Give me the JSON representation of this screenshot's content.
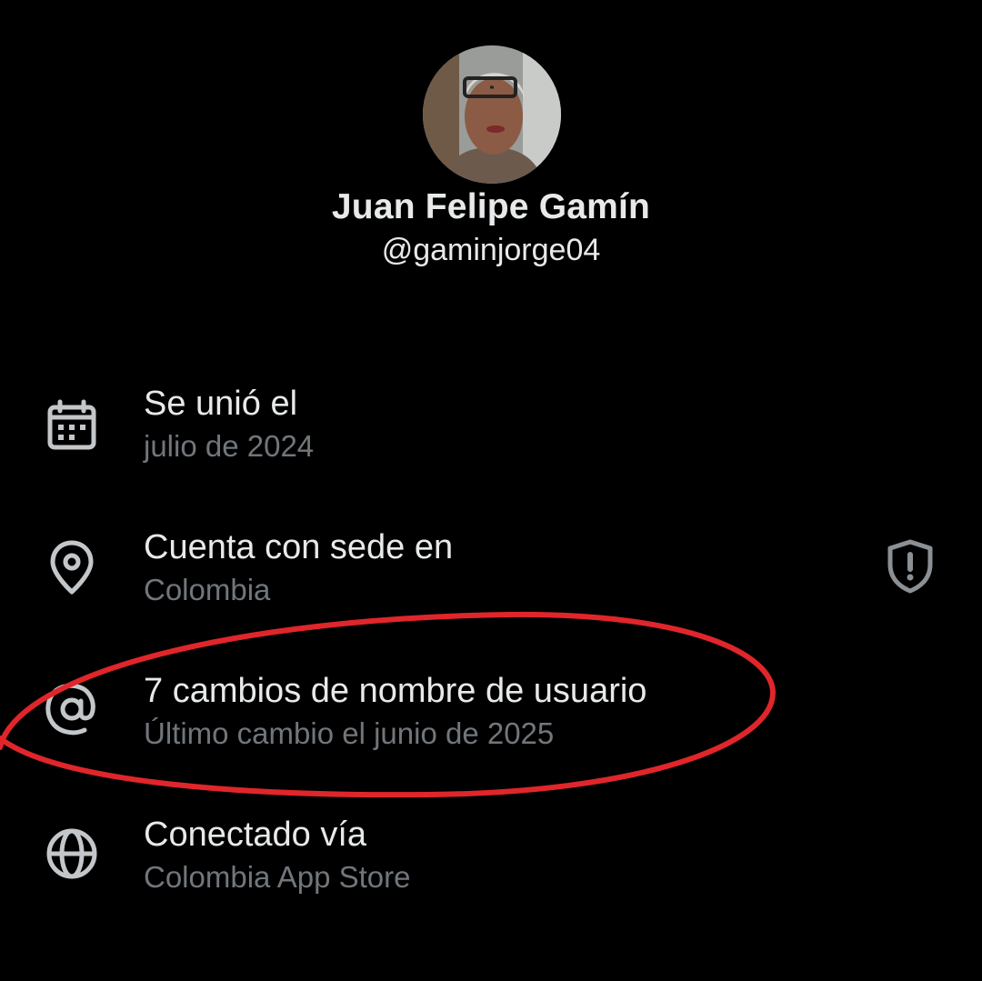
{
  "profile": {
    "display_name": "Juan Felipe Gamín",
    "handle": "@gaminjorge04"
  },
  "about": {
    "joined": {
      "title": "Se unió el",
      "value": "julio de 2024",
      "icon": "calendar-icon"
    },
    "location": {
      "title": "Cuenta con sede en",
      "value": "Colombia",
      "icon": "location-pin-icon",
      "badge_icon": "shield-alert-icon"
    },
    "username_changes": {
      "title": "7 cambios de nombre de usuario",
      "value": "Último cambio el junio de 2025",
      "icon": "at-sign-icon"
    },
    "connected": {
      "title": "Conectado vía",
      "value": "Colombia App Store",
      "icon": "globe-icon"
    }
  },
  "colors": {
    "background": "#000000",
    "primary_text": "#e7e9ea",
    "secondary_text": "#71767b",
    "annotation": "#e0262b"
  }
}
